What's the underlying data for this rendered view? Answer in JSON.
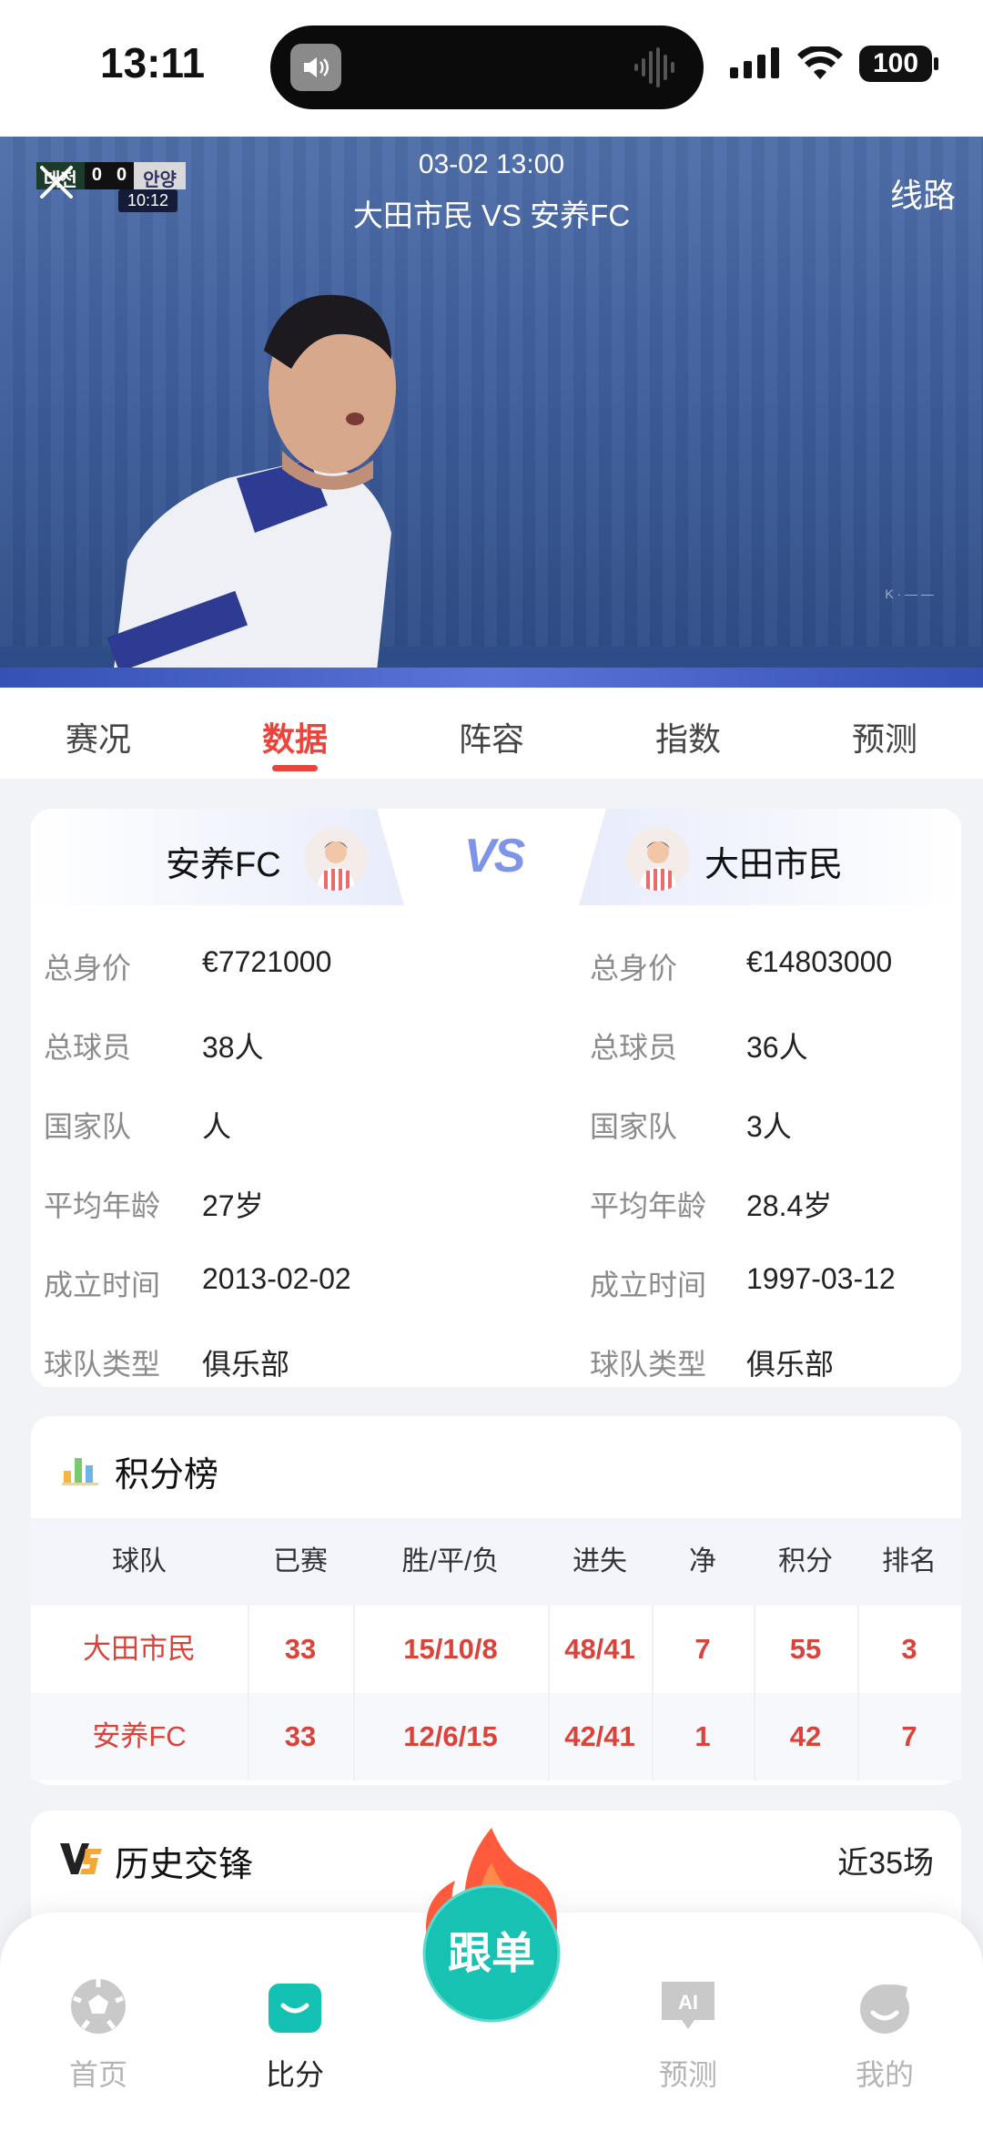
{
  "status_bar": {
    "time": "13:11",
    "battery": "100"
  },
  "video": {
    "match_time": "03-02 13:00",
    "match_title": "大田市民 VS 安养FC",
    "route_label": "线路",
    "scorebug": {
      "home": "대전",
      "home_score": "0",
      "away_score": "0",
      "away": "안양",
      "clock": "10:12"
    }
  },
  "tabs": [
    {
      "label": "赛况"
    },
    {
      "label": "数据",
      "active": true
    },
    {
      "label": "阵容"
    },
    {
      "label": "指数"
    },
    {
      "label": "预测"
    }
  ],
  "teams": {
    "left": {
      "name": "安养FC",
      "stats": [
        {
          "label": "总身价",
          "value": "€7721000"
        },
        {
          "label": "总球员",
          "value": "38人"
        },
        {
          "label": "国家队",
          "value": "人"
        },
        {
          "label": "平均年龄",
          "value": "27岁"
        },
        {
          "label": "成立时间",
          "value": "2013-02-02"
        },
        {
          "label": "球队类型",
          "value": "俱乐部"
        }
      ]
    },
    "vs_label": "VS",
    "right": {
      "name": "大田市民",
      "stats": [
        {
          "label": "总身价",
          "value": "€14803000"
        },
        {
          "label": "总球员",
          "value": "36人"
        },
        {
          "label": "国家队",
          "value": "3人"
        },
        {
          "label": "平均年龄",
          "value": "28.4岁"
        },
        {
          "label": "成立时间",
          "value": "1997-03-12"
        },
        {
          "label": "球队类型",
          "value": "俱乐部"
        }
      ]
    }
  },
  "standings": {
    "title": "积分榜",
    "headers": [
      "球队",
      "已赛",
      "胜/平/负",
      "进失",
      "净",
      "积分",
      "排名"
    ],
    "rows": [
      [
        "大田市民",
        "33",
        "15/10/8",
        "48/41",
        "7",
        "55",
        "3"
      ],
      [
        "安养FC",
        "33",
        "12/6/15",
        "42/41",
        "1",
        "42",
        "7"
      ]
    ]
  },
  "history": {
    "title": "历史交锋",
    "more": "近35场"
  },
  "follow_button": "跟单",
  "bottom_nav": [
    {
      "label": "首页",
      "icon": "soccer-ball-icon"
    },
    {
      "label": "比分",
      "icon": "score-icon",
      "active": true
    },
    {
      "label": "预测",
      "icon": "ai-icon"
    },
    {
      "label": "我的",
      "icon": "profile-icon"
    }
  ],
  "colors": {
    "accent": "#e8453c",
    "vs": "#7e94e8",
    "teal": "#18c2b3"
  }
}
